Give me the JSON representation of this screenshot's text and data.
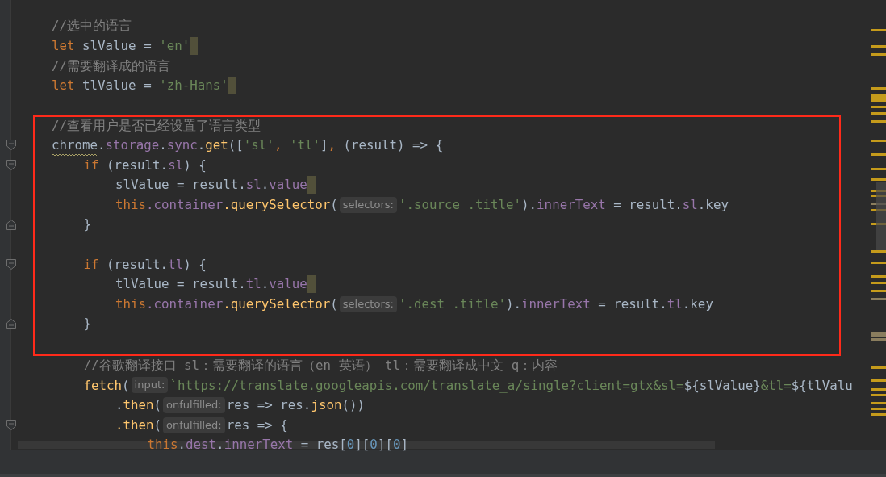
{
  "editor": {
    "lines": [
      {
        "tokens": [
          {
            "text": "//选中的语言",
            "kind": "comment"
          }
        ]
      },
      {
        "caret_block": true,
        "tokens": [
          {
            "text": "let",
            "kind": "kw"
          },
          {
            "text": " slValue = ",
            "kind": "plain"
          },
          {
            "text": "'en'",
            "kind": "str"
          }
        ]
      },
      {
        "tokens": [
          {
            "text": "//需要翻译成的语言",
            "kind": "comment"
          }
        ]
      },
      {
        "caret_block": true,
        "tokens": [
          {
            "text": "let",
            "kind": "kw"
          },
          {
            "text": " tlValue = ",
            "kind": "plain"
          },
          {
            "text": "'zh-Hans'",
            "kind": "str"
          }
        ]
      },
      {
        "blank": true
      },
      {
        "boxed": true,
        "tokens": [
          {
            "text": "//查看用户是否已经设置了语言类型",
            "kind": "comment"
          }
        ]
      },
      {
        "boxed": true,
        "fold_start": true,
        "tokens": [
          {
            "text": "chrome",
            "kind": "plain",
            "squiggle": true
          },
          {
            "text": ".",
            "kind": "plain"
          },
          {
            "text": "storage",
            "kind": "prop"
          },
          {
            "text": ".",
            "kind": "plain"
          },
          {
            "text": "sync",
            "kind": "prop"
          },
          {
            "text": ".",
            "kind": "plain"
          },
          {
            "text": "get",
            "kind": "fn"
          },
          {
            "text": "([",
            "kind": "plain"
          },
          {
            "text": "'sl'",
            "kind": "str"
          },
          {
            "text": ", ",
            "kind": "kw"
          },
          {
            "text": "'tl'",
            "kind": "str"
          },
          {
            "text": "]",
            "kind": "plain"
          },
          {
            "text": ", ",
            "kind": "kw"
          },
          {
            "text": "(result) => {",
            "kind": "plain"
          }
        ],
        "children": [
          {
            "boxed": true,
            "fold_start": true,
            "tokens": [
              {
                "text": "if",
                "kind": "kw"
              },
              {
                "text": " (result.",
                "kind": "plain"
              },
              {
                "text": "sl",
                "kind": "prop"
              },
              {
                "text": ") {",
                "kind": "plain"
              }
            ],
            "children": [
              {
                "boxed": true,
                "caret_block": true,
                "tokens": [
                  {
                    "text": "slValue = result.",
                    "kind": "plain"
                  },
                  {
                    "text": "sl",
                    "kind": "prop"
                  },
                  {
                    "text": ".",
                    "kind": "plain"
                  },
                  {
                    "text": "value",
                    "kind": "prop"
                  }
                ]
              },
              {
                "boxed": true,
                "tokens": [
                  {
                    "text": "this",
                    "kind": "kw"
                  },
                  {
                    "text": ".container",
                    "kind": "prop"
                  },
                  {
                    "text": ".querySelector",
                    "kind": "fn"
                  },
                  {
                    "text": "(",
                    "kind": "plain"
                  },
                  {
                    "text": "selectors:",
                    "kind": "hint"
                  },
                  {
                    "text": "'.source .title'",
                    "kind": "str"
                  },
                  {
                    "text": ").",
                    "kind": "plain"
                  },
                  {
                    "text": "innerText",
                    "kind": "prop"
                  },
                  {
                    "text": " = result.",
                    "kind": "plain"
                  },
                  {
                    "text": "sl",
                    "kind": "prop"
                  },
                  {
                    "text": ".key",
                    "kind": "plain"
                  }
                ]
              }
            ]
          },
          {
            "boxed": true,
            "fold_end": true,
            "tokens": [
              {
                "text": "}",
                "kind": "plain"
              }
            ]
          },
          {
            "boxed": true,
            "blank": true
          },
          {
            "boxed": true,
            "fold_start": true,
            "tokens": [
              {
                "text": "if",
                "kind": "kw"
              },
              {
                "text": " (result.",
                "kind": "plain"
              },
              {
                "text": "tl",
                "kind": "prop"
              },
              {
                "text": ") {",
                "kind": "plain"
              }
            ],
            "children": [
              {
                "boxed": true,
                "caret_block": true,
                "tokens": [
                  {
                    "text": "tlValue = result.",
                    "kind": "plain"
                  },
                  {
                    "text": "tl",
                    "kind": "prop"
                  },
                  {
                    "text": ".",
                    "kind": "plain"
                  },
                  {
                    "text": "value",
                    "kind": "prop"
                  }
                ]
              },
              {
                "boxed": true,
                "tokens": [
                  {
                    "text": "this",
                    "kind": "kw"
                  },
                  {
                    "text": ".container",
                    "kind": "prop"
                  },
                  {
                    "text": ".querySelector",
                    "kind": "fn"
                  },
                  {
                    "text": "(",
                    "kind": "plain"
                  },
                  {
                    "text": "selectors:",
                    "kind": "hint"
                  },
                  {
                    "text": "'.dest .title'",
                    "kind": "str"
                  },
                  {
                    "text": ").",
                    "kind": "plain"
                  },
                  {
                    "text": "innerText",
                    "kind": "prop"
                  },
                  {
                    "text": " = result.",
                    "kind": "plain"
                  },
                  {
                    "text": "tl",
                    "kind": "prop"
                  },
                  {
                    "text": ".key",
                    "kind": "plain"
                  }
                ]
              }
            ]
          },
          {
            "boxed": true,
            "fold_end": true,
            "tokens": [
              {
                "text": "}",
                "kind": "plain"
              }
            ]
          },
          {
            "boxed": true,
            "blank": true
          },
          {
            "tokens": [
              {
                "text": "//谷歌翻译接口 sl：需要翻译的语言（en 英语） tl：需要翻译成中文 q：内容",
                "kind": "comment"
              }
            ]
          },
          {
            "tokens": [
              {
                "text": "fetch",
                "kind": "fn"
              },
              {
                "text": "(",
                "kind": "plain"
              },
              {
                "text": "input:",
                "kind": "hint"
              },
              {
                "text": "`https://translate.googleapis.com/translate_a/single?client=gtx&sl=",
                "kind": "str"
              },
              {
                "text": "${slValue}",
                "kind": "plain"
              },
              {
                "text": "&tl=",
                "kind": "str"
              },
              {
                "text": "${tlValu",
                "kind": "plain"
              }
            ],
            "children": [
              {
                "tokens": [
                  {
                    "text": ".",
                    "kind": "plain"
                  },
                  {
                    "text": "then",
                    "kind": "fn"
                  },
                  {
                    "text": "(",
                    "kind": "plain"
                  },
                  {
                    "text": "onfulfilled:",
                    "kind": "hint"
                  },
                  {
                    "text": "res => res.",
                    "kind": "plain"
                  },
                  {
                    "text": "json",
                    "kind": "fn"
                  },
                  {
                    "text": "())",
                    "kind": "plain"
                  }
                ]
              },
              {
                "fold_start": true,
                "tokens": [
                  {
                    "text": ".then",
                    "kind": "fn"
                  },
                  {
                    "text": "(",
                    "kind": "plain"
                  },
                  {
                    "text": "onfulfilled:",
                    "kind": "hint"
                  },
                  {
                    "text": "res => {",
                    "kind": "plain"
                  }
                ],
                "children": [
                  {
                    "tokens": [
                      {
                        "text": "this",
                        "kind": "kw"
                      },
                      {
                        "text": ".",
                        "kind": "plain"
                      },
                      {
                        "text": "dest",
                        "kind": "prop"
                      },
                      {
                        "text": ".",
                        "kind": "plain"
                      },
                      {
                        "text": "innerText",
                        "kind": "prop"
                      },
                      {
                        "text": " = res[",
                        "kind": "plain"
                      },
                      {
                        "text": "0",
                        "kind": "num"
                      },
                      {
                        "text": "][",
                        "kind": "plain"
                      },
                      {
                        "text": "0",
                        "kind": "num"
                      },
                      {
                        "text": "][",
                        "kind": "plain"
                      },
                      {
                        "text": "0",
                        "kind": "num"
                      },
                      {
                        "text": "]",
                        "kind": "plain"
                      }
                    ]
                  }
                ]
              }
            ]
          }
        ]
      }
    ]
  }
}
